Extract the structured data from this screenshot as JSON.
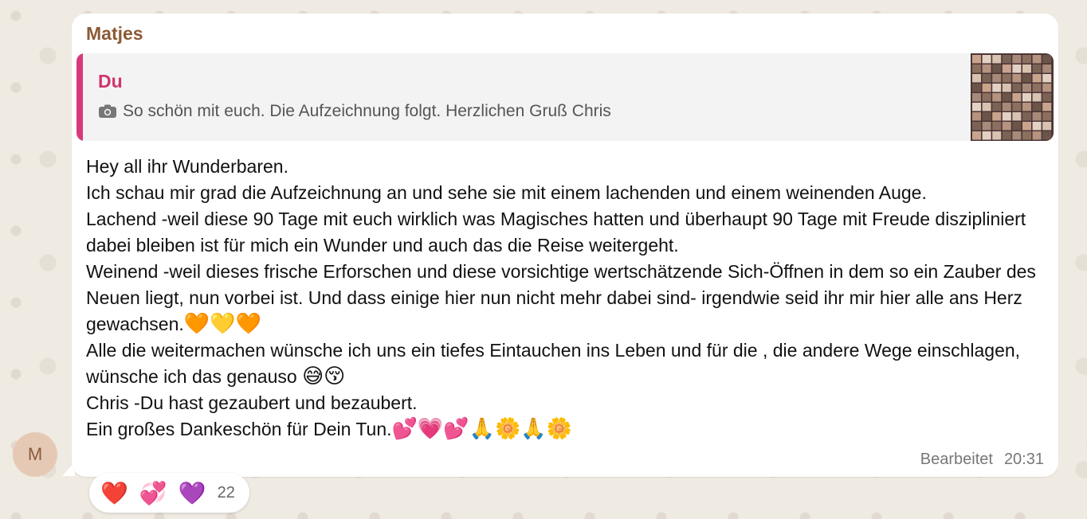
{
  "message": {
    "sender": "Matjes",
    "avatar_initial": "M",
    "quoted": {
      "author": "Du",
      "text": "So schön mit euch. Die Aufzeichnung folgt. Herzlichen Gruß Chris",
      "icon": "camera-icon"
    },
    "lines": [
      "Hey all ihr Wunderbaren.",
      "Ich schau mir grad die Aufzeichnung an und sehe sie mit einem lachenden und einem weinenden Auge.",
      "Lachend -weil diese 90 Tage mit euch wirklich was Magisches hatten und überhaupt 90 Tage mit Freude diszipliniert dabei bleiben ist für mich ein Wunder und auch das die Reise weitergeht.",
      "Weinend -weil dieses frische Erforschen und diese vorsichtige wertschätzende Sich-Öffnen in dem so ein Zauber des Neuen liegt,  nun vorbei ist. Und dass einige hier nun nicht mehr dabei sind- irgendwie seid ihr mir hier alle ans Herz gewachsen.",
      "Alle die weitermachen wünsche ich uns ein tiefes Eintauchen ins Leben und für die , die andere Wege einschlagen, wünsche ich das genauso",
      "Chris -Du hast gezaubert und bezaubert.",
      "Ein großes Dankeschön für Dein Tun."
    ],
    "emojis": {
      "line4": "🧡💛🧡",
      "line5": "😅😚",
      "line7": "💕💗💕🙏🌼🙏🌼"
    },
    "edited_label": "Bearbeitet",
    "time": "20:31"
  },
  "reactions": {
    "emojis": [
      "❤️",
      "💞",
      "💜"
    ],
    "count": "22"
  },
  "colors": {
    "sender": "#8b5a35",
    "quote_author": "#d0346e",
    "quote_bar": "#d63a7a",
    "background": "#efeae2"
  }
}
